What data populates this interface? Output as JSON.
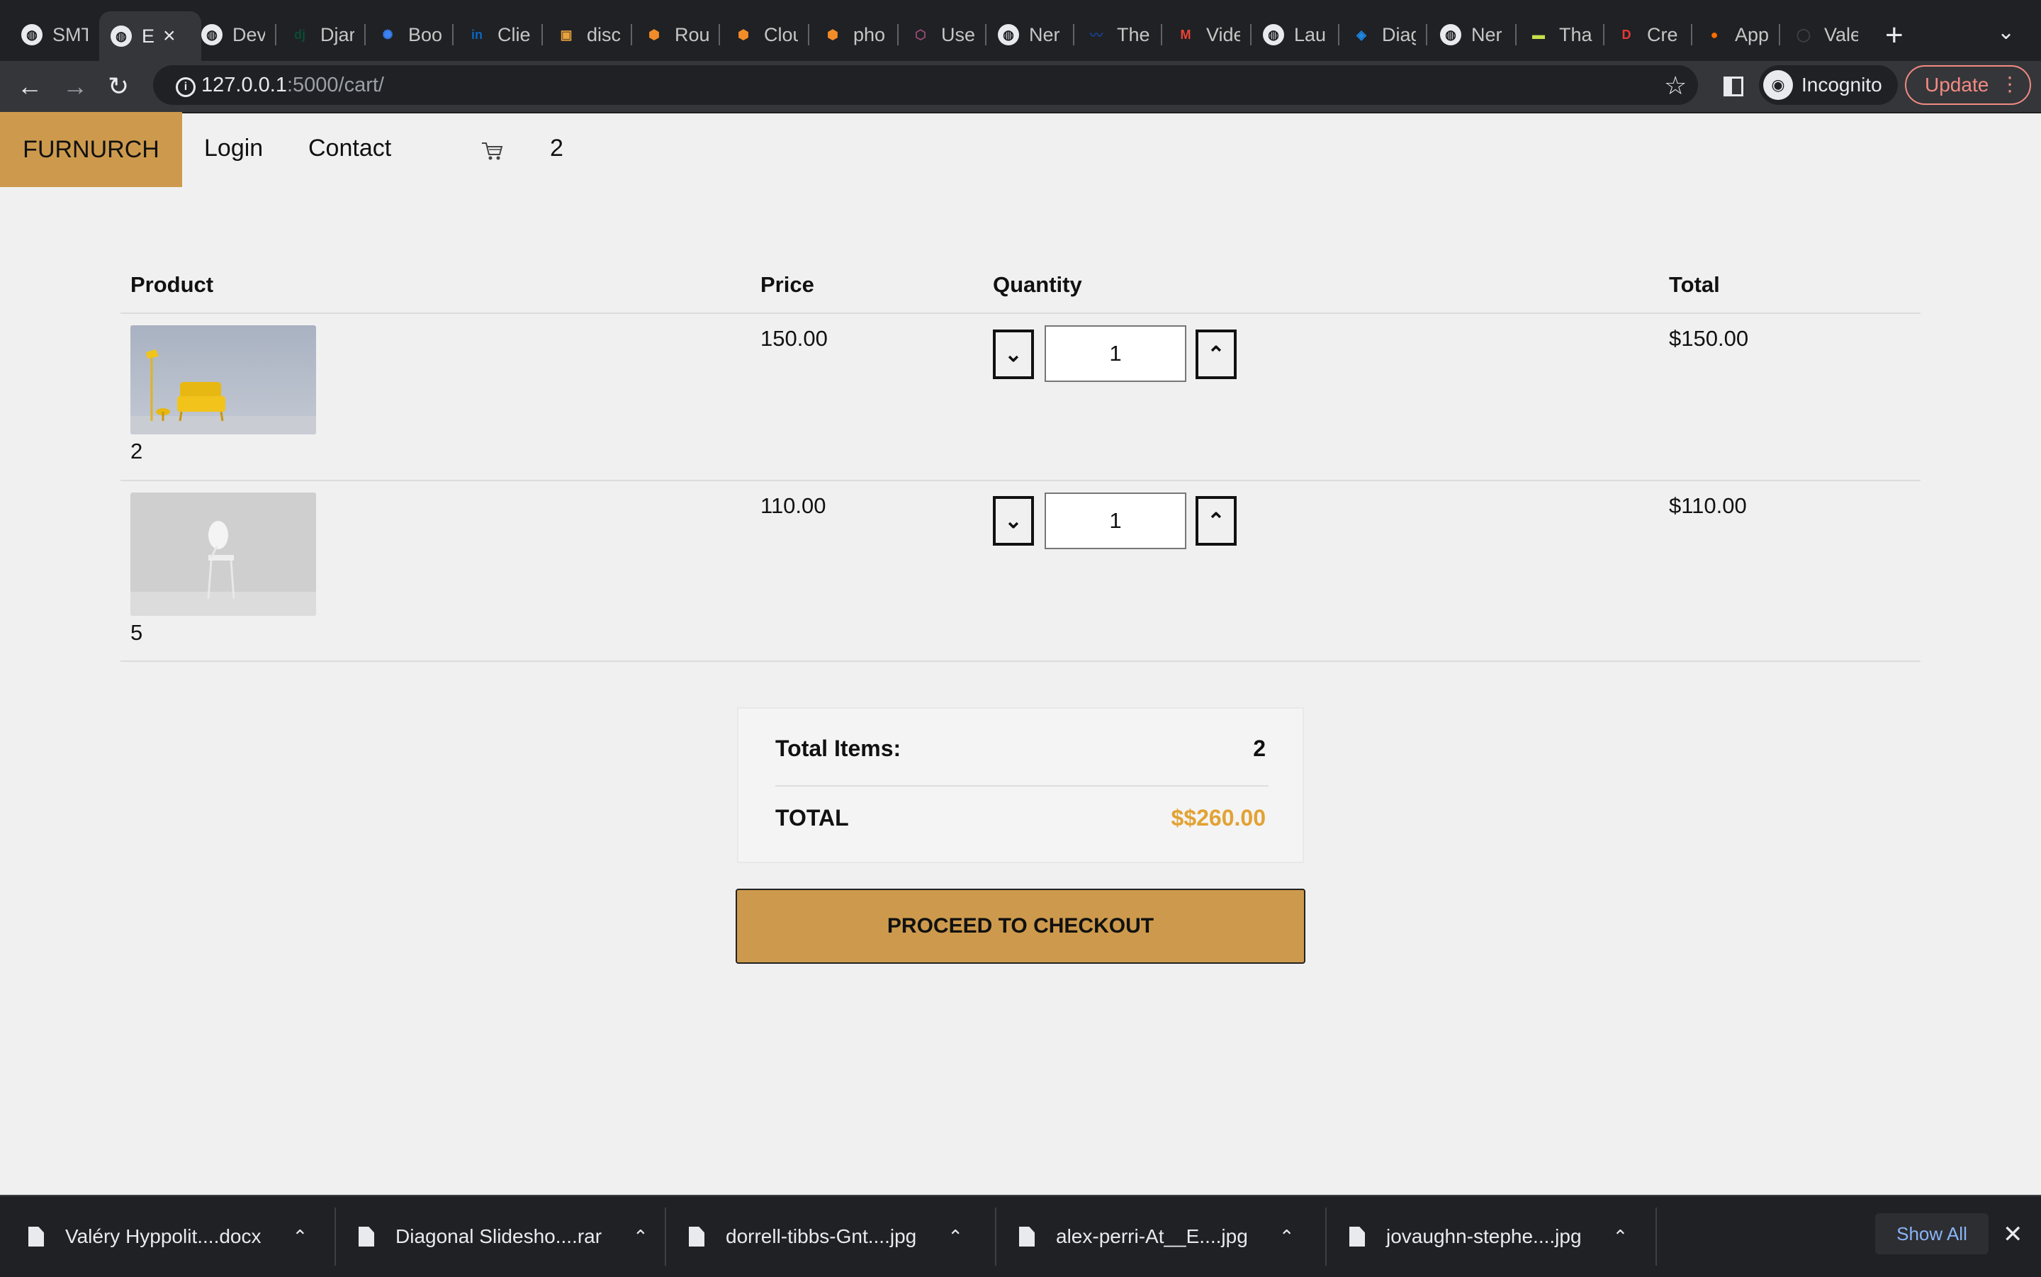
{
  "browser": {
    "tabs": [
      {
        "label": "SMT",
        "icon": "globe-icon",
        "color": "#e8eaed"
      },
      {
        "label": "E",
        "icon": "globe-icon",
        "color": "#e8eaed",
        "active": true
      },
      {
        "label": "Dev",
        "icon": "globe-icon",
        "color": "#e8eaed"
      },
      {
        "label": "Djar",
        "icon": "django-icon",
        "color": "#0c4b33"
      },
      {
        "label": "Boo",
        "icon": "bootstrap-icon",
        "color": "#3b82f6"
      },
      {
        "label": "Clie",
        "icon": "linkedin-icon",
        "color": "#0a66c2"
      },
      {
        "label": "disc",
        "icon": "box-icon",
        "color": "#e8a33d"
      },
      {
        "label": "Rou",
        "icon": "cube-icon",
        "color": "#f28c28"
      },
      {
        "label": "Clou",
        "icon": "cube-icon",
        "color": "#f28c28"
      },
      {
        "label": "pho",
        "icon": "cube-icon",
        "color": "#f28c28"
      },
      {
        "label": "Use",
        "icon": "hexagon-icon",
        "color": "#9c4d7a"
      },
      {
        "label": "Ner",
        "icon": "globe-icon",
        "color": "#e8eaed"
      },
      {
        "label": "The",
        "icon": "wave-icon",
        "color": "#1a3f8f"
      },
      {
        "label": "Vide",
        "icon": "gmail-icon",
        "color": "#ea4335"
      },
      {
        "label": "Lau",
        "icon": "globe-icon",
        "color": "#e8eaed"
      },
      {
        "label": "Diag",
        "icon": "diagram-icon",
        "color": "#1e88e5"
      },
      {
        "label": "Ner",
        "icon": "globe-icon",
        "color": "#e8eaed"
      },
      {
        "label": "Tha",
        "icon": "badge-icon",
        "color": "#c6e04d"
      },
      {
        "label": "Cre",
        "icon": "d-logo-icon",
        "color": "#e53935"
      },
      {
        "label": "App",
        "icon": "orange-dot-icon",
        "color": "#ff6d00"
      },
      {
        "label": "Vale",
        "icon": "github-icon",
        "color": "#3c4043"
      }
    ],
    "new_tab": "+",
    "tab_search": "⌄",
    "url_host": "127.0.0.1",
    "url_path": ":5000/cart/",
    "incognito_label": "Incognito",
    "update_label": "Update"
  },
  "site": {
    "brand": "FURNURCH",
    "nav": [
      "Login",
      "Contact"
    ],
    "cart_count": "2",
    "accent_color": "#cd9a4d"
  },
  "cart": {
    "headers": {
      "product": "Product",
      "price": "Price",
      "quantity": "Quantity",
      "total": "Total"
    },
    "items": [
      {
        "name": "2",
        "price": "150.00",
        "quantity": "1",
        "total": "$150.00",
        "image": "yellow-armchair"
      },
      {
        "name": "5",
        "price": "110.00",
        "quantity": "1",
        "total": "$110.00",
        "image": "white-chair"
      }
    ],
    "summary": {
      "items_label": "Total Items:",
      "items_value": "2",
      "total_label": "TOTAL",
      "total_value": "$$260.00",
      "total_color": "#e2a234"
    },
    "checkout_label": "PROCEED TO CHECKOUT"
  },
  "downloads": {
    "files": [
      "Valéry Hyppolit....docx",
      "Diagonal Slidesho....rar",
      "dorrell-tibbs-Gnt....jpg",
      "alex-perri-At__E....jpg",
      "jovaughn-stephe....jpg"
    ],
    "show_all": "Show All"
  }
}
